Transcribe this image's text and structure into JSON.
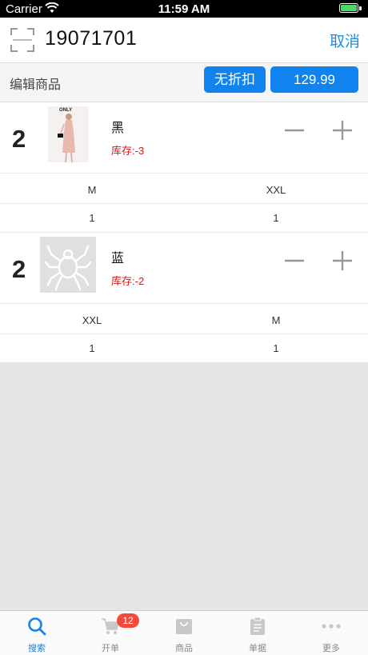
{
  "status_bar": {
    "carrier": "Carrier",
    "time": "11:59 AM"
  },
  "header": {
    "order_no": "19071701",
    "cancel_label": "取消"
  },
  "edit_bar": {
    "label": "编辑商品",
    "discount_label": "无折扣",
    "price": "129.99"
  },
  "products": [
    {
      "qty": "2",
      "name": "黑",
      "stock": "库存:-3",
      "sizes": [
        "M",
        "XXL"
      ],
      "counts": [
        "1",
        "1"
      ]
    },
    {
      "qty": "2",
      "name": "蓝",
      "stock": "库存:-2",
      "sizes": [
        "XXL",
        "M"
      ],
      "counts": [
        "1",
        "1"
      ]
    }
  ],
  "tabs": [
    {
      "label": "搜索",
      "icon": "search-icon",
      "active": true
    },
    {
      "label": "开单",
      "icon": "cart-icon",
      "badge": "12"
    },
    {
      "label": "商品",
      "icon": "bag-icon"
    },
    {
      "label": "单据",
      "icon": "document-icon"
    },
    {
      "label": "更多",
      "icon": "more-icon"
    }
  ],
  "colors": {
    "accent": "#1083ee",
    "stock_warning": "#d21a1a",
    "badge": "#f4493a"
  }
}
